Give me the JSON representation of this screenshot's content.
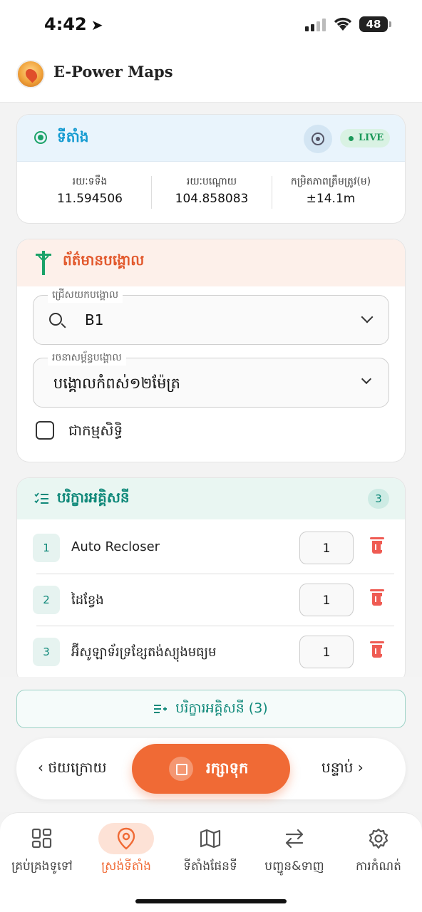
{
  "status": {
    "time": "4:42",
    "battery": "48"
  },
  "app": {
    "title": "E-Power Maps"
  },
  "location": {
    "title": "ទីតាំង",
    "live": "LIVE",
    "lat_label": "រយៈទទឹង",
    "lat_value": "11.594506",
    "lon_label": "រយៈបណ្ដោយ",
    "lon_value": "104.858083",
    "acc_label": "កម្រិតភាពត្រឹមត្រូវ(ម)",
    "acc_value": "±14.1m"
  },
  "pole": {
    "title": "ព័ត៌មានបង្គោល",
    "select_label": "ជ្រើសយកបង្គោល",
    "select_value": "B1",
    "structure_label": "រចនាសម្ព័ន្ធបង្គោល",
    "structure_value": "បង្គោលកំពស់១២ម៉ែត្រ",
    "owned_label": "ជាកម្មសិទ្ធិ",
    "owned": false
  },
  "equipment": {
    "title": "បរិក្ខារអគ្គិសនី",
    "count": "3",
    "items": [
      {
        "num": "1",
        "name": "Auto Recloser",
        "qty": "1"
      },
      {
        "num": "2",
        "name": "ដៃខ្វែង",
        "qty": "1"
      },
      {
        "num": "3",
        "name": "អ៊ីសូឡាទ័រទ្រខ្សែតង់ស្យុងមធ្យម",
        "qty": "1"
      }
    ],
    "summary_button": "បរិក្ខារអគ្គិសនី (3)"
  },
  "nav": {
    "back": "ថយក្រោយ",
    "save": "រក្សាទុក",
    "next": "បន្ទាប់"
  },
  "tabs": [
    {
      "label": "គ្រប់គ្រងទូទៅ",
      "icon": "dashboard-icon"
    },
    {
      "label": "ស្រង់ទីតាំង",
      "icon": "location-pin-icon",
      "active": true
    },
    {
      "label": "ទីតាំងផែនទី",
      "icon": "map-icon"
    },
    {
      "label": "បញ្ជូន&ទាញ",
      "icon": "transfer-icon"
    },
    {
      "label": "ការកំណត់",
      "icon": "gear-icon"
    }
  ],
  "colors": {
    "accent": "#f06a35",
    "teal": "#10897a",
    "blue": "#159bd1",
    "green": "#1aa268"
  }
}
